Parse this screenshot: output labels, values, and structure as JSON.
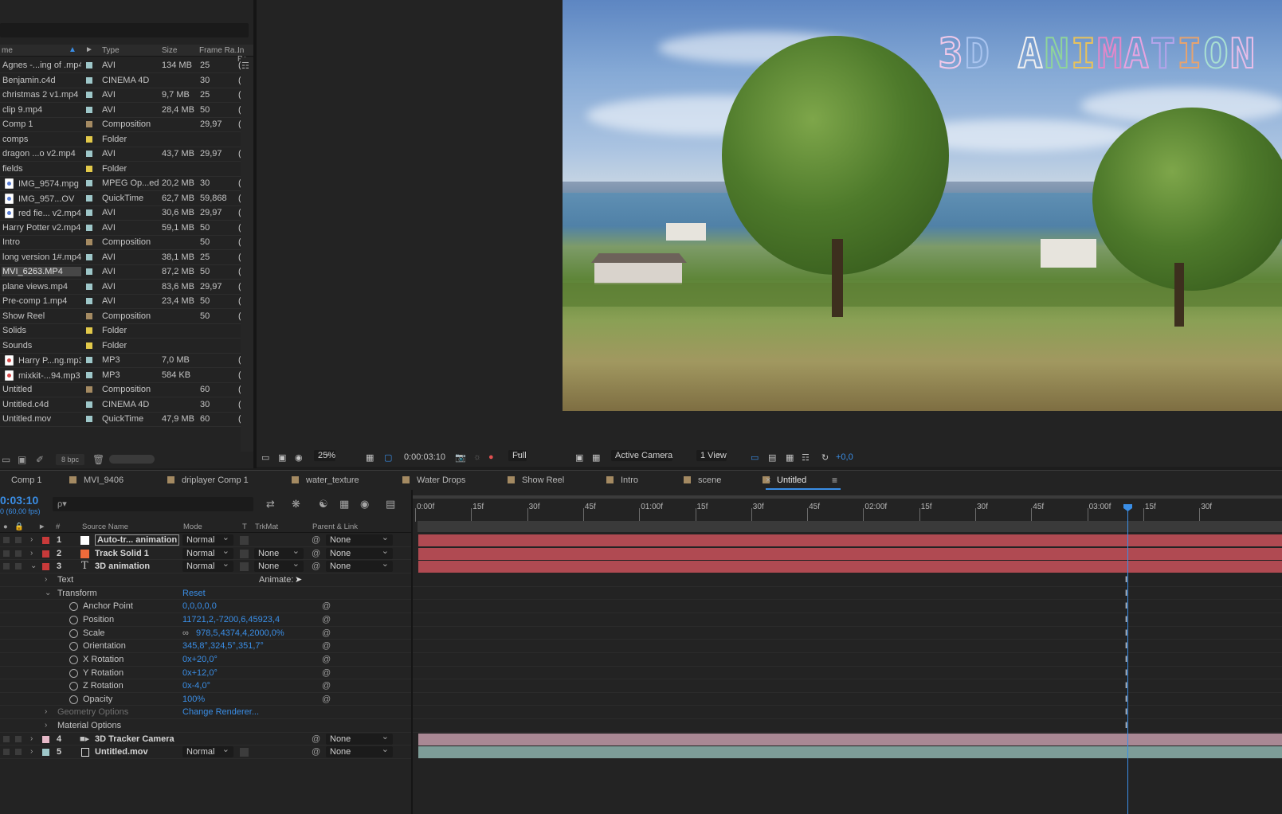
{
  "project": {
    "columns": {
      "name": "me",
      "type": "Type",
      "size": "Size",
      "frame_rate": "Frame Ra...",
      "in_point": "In Po"
    },
    "items": [
      {
        "name": "Agnes -...ing of .mp4",
        "color": "#9ec7c9",
        "type": "AVI",
        "size": "134 MB",
        "rate": "25",
        "in": "(",
        "icon": "none"
      },
      {
        "name": "Benjamin.c4d",
        "color": "#9ec7c9",
        "type": "CINEMA 4D",
        "size": "",
        "rate": "30",
        "in": "(",
        "icon": "none"
      },
      {
        "name": "christmas 2 v1.mp4",
        "color": "#9ec7c9",
        "type": "AVI",
        "size": "9,7 MB",
        "rate": "25",
        "in": "(",
        "icon": "none"
      },
      {
        "name": "clip 9.mp4",
        "color": "#9ec7c9",
        "type": "AVI",
        "size": "28,4 MB",
        "rate": "50",
        "in": "(",
        "icon": "none"
      },
      {
        "name": "Comp 1",
        "color": "#a48a62",
        "type": "Composition",
        "size": "",
        "rate": "29,97",
        "in": "(",
        "icon": "none"
      },
      {
        "name": "comps",
        "color": "#e2c94a",
        "type": "Folder",
        "size": "",
        "rate": "",
        "in": "",
        "icon": "none"
      },
      {
        "name": "dragon ...o v2.mp4",
        "color": "#9ec7c9",
        "type": "AVI",
        "size": "43,7 MB",
        "rate": "29,97",
        "in": "(",
        "icon": "none"
      },
      {
        "name": "fields",
        "color": "#e2c94a",
        "type": "Folder",
        "size": "",
        "rate": "",
        "in": "",
        "icon": "none"
      },
      {
        "name": "IMG_9574.mpg",
        "color": "#9ec7c9",
        "type": "MPEG Op...ed",
        "size": "20,2 MB",
        "rate": "30",
        "in": "(",
        "icon": "video"
      },
      {
        "name": "IMG_957...OV",
        "color": "#9ec7c9",
        "type": "QuickTime",
        "size": "62,7 MB",
        "rate": "59,868",
        "in": "(",
        "icon": "video"
      },
      {
        "name": "red fie... v2.mp4",
        "color": "#9ec7c9",
        "type": "AVI",
        "size": "30,6 MB",
        "rate": "29,97",
        "in": "(",
        "icon": "video"
      },
      {
        "name": "Harry Potter v2.mp4",
        "color": "#9ec7c9",
        "type": "AVI",
        "size": "59,1 MB",
        "rate": "50",
        "in": "(",
        "icon": "none"
      },
      {
        "name": "Intro",
        "color": "#a48a62",
        "type": "Composition",
        "size": "",
        "rate": "50",
        "in": "(",
        "icon": "none"
      },
      {
        "name": "long version 1#.mp4",
        "color": "#9ec7c9",
        "type": "AVI",
        "size": "38,1 MB",
        "rate": "25",
        "in": "(",
        "icon": "none"
      },
      {
        "name": "MVI_6263.MP4",
        "color": "#9ec7c9",
        "type": "AVI",
        "size": "87,2 MB",
        "rate": "50",
        "in": "(",
        "icon": "none",
        "selected": true
      },
      {
        "name": "plane views.mp4",
        "color": "#9ec7c9",
        "type": "AVI",
        "size": "83,6 MB",
        "rate": "29,97",
        "in": "(",
        "icon": "none"
      },
      {
        "name": "Pre-comp 1.mp4",
        "color": "#9ec7c9",
        "type": "AVI",
        "size": "23,4 MB",
        "rate": "50",
        "in": "(",
        "icon": "none"
      },
      {
        "name": "Show Reel",
        "color": "#a48a62",
        "type": "Composition",
        "size": "",
        "rate": "50",
        "in": "(",
        "icon": "none"
      },
      {
        "name": "Solids",
        "color": "#e2c94a",
        "type": "Folder",
        "size": "",
        "rate": "",
        "in": "",
        "icon": "none"
      },
      {
        "name": "Sounds",
        "color": "#e2c94a",
        "type": "Folder",
        "size": "",
        "rate": "",
        "in": "",
        "icon": "none"
      },
      {
        "name": "Harry P...ng.mp3",
        "color": "#9ec7c9",
        "type": "MP3",
        "size": "7,0 MB",
        "rate": "",
        "in": "(",
        "icon": "audio"
      },
      {
        "name": "mixkit-...94.mp3",
        "color": "#9ec7c9",
        "type": "MP3",
        "size": "584 KB",
        "rate": "",
        "in": "(",
        "icon": "audio"
      },
      {
        "name": "Untitled",
        "color": "#a48a62",
        "type": "Composition",
        "size": "",
        "rate": "60",
        "in": "(",
        "icon": "none"
      },
      {
        "name": "Untitled.c4d",
        "color": "#9ec7c9",
        "type": "CINEMA 4D",
        "size": "",
        "rate": "30",
        "in": "(",
        "icon": "none"
      },
      {
        "name": "Untitled.mov",
        "color": "#9ec7c9",
        "type": "QuickTime",
        "size": "47,9 MB",
        "rate": "60",
        "in": "(",
        "icon": "none"
      }
    ],
    "footer": {
      "bpc": "8 bpc"
    }
  },
  "viewer": {
    "title_text": "3D ANIMATION",
    "title_letter_colors": [
      "#f1c9e9",
      "#a9c4ef",
      "#f0f0f0",
      "#8fd49b",
      "#e8c25b",
      "#e387c9",
      "#e9a3e0",
      "#b4a4ea",
      "#e6a36f",
      "#a9e0d2",
      "#e7bde8",
      "#f3d3ef"
    ],
    "bar": {
      "zoom": "25%",
      "timecode": "0:00:03:10",
      "resolution": "Full",
      "camera": "Active Camera",
      "views": "1 View",
      "exposure": "+0,0"
    }
  },
  "timeline": {
    "tabs": [
      {
        "label": "Comp 1",
        "swatch": false
      },
      {
        "label": "MVI_9406",
        "swatch": true
      },
      {
        "label": "driplayer Comp 1",
        "swatch": true
      },
      {
        "label": "water_texture",
        "swatch": true
      },
      {
        "label": "Water Drops",
        "swatch": true
      },
      {
        "label": "Show Reel",
        "swatch": true
      },
      {
        "label": "Intro",
        "swatch": true
      },
      {
        "label": "scene",
        "swatch": true
      },
      {
        "label": "Untitled",
        "swatch": true,
        "active": true
      }
    ],
    "close_glyph": "×",
    "menu_glyph": "≡",
    "timecode": "0:03:10",
    "fps": "0 (60,00 fps)",
    "search_placeholder": "ρ▾",
    "columns": {
      "hash": "#",
      "source": "Source Name",
      "mode": "Mode",
      "t": "T",
      "trkmat": "TrkMat",
      "parent": "Parent & Link"
    },
    "layers": [
      {
        "num": "1",
        "name": "Auto-tr... animation",
        "label_color": "#c83a3a",
        "mode": "Normal",
        "trkmat": "",
        "parent": "None",
        "icon": "solid-white"
      },
      {
        "num": "2",
        "name": "Track Solid 1",
        "label_color": "#c83a3a",
        "mode": "Normal",
        "trkmat": "None",
        "parent": "None",
        "icon": "solid-orange"
      },
      {
        "num": "3",
        "name": "3D animation",
        "label_color": "#c83a3a",
        "mode": "Normal",
        "trkmat": "None",
        "parent": "None",
        "icon": "text"
      },
      {
        "num": "4",
        "name": "3D Tracker Camera",
        "label_color": "#e6b9c8",
        "mode": "",
        "trkmat": "",
        "parent": "None",
        "icon": "camera"
      },
      {
        "num": "5",
        "name": "Untitled.mov",
        "label_color": "#9ec7c9",
        "mode": "Normal",
        "trkmat": "",
        "parent": "None",
        "icon": "footage"
      }
    ],
    "text_group": {
      "label": "Text",
      "animate_label": "Animate:"
    },
    "transform": {
      "label": "Transform",
      "reset": "Reset",
      "props": [
        {
          "name": "Anchor Point",
          "value": "0,0,0,0,0"
        },
        {
          "name": "Position",
          "value": "11721,2,-7200,6,45923,4"
        },
        {
          "name": "Scale",
          "value": "978,5,4374,4,2000,0%"
        },
        {
          "name": "Orientation",
          "value": "345,8°,324,5°,351,7°"
        },
        {
          "name": "X Rotation",
          "value": "0x+20,0°"
        },
        {
          "name": "Y Rotation",
          "value": "0x+12,0°"
        },
        {
          "name": "Z Rotation",
          "value": "0x-4,0°"
        },
        {
          "name": "Opacity",
          "value": "100%"
        }
      ]
    },
    "geometry": {
      "label": "Geometry Options",
      "action": "Change Renderer..."
    },
    "material": {
      "label": "Material Options"
    },
    "ruler_labels": [
      "0:00f",
      "15f",
      "30f",
      "45f",
      "01:00f",
      "15f",
      "30f",
      "45f",
      "02:00f",
      "15f",
      "30f",
      "45f",
      "03:00f",
      "15f",
      "30f"
    ],
    "layer_bar_colors": [
      "#b04a52",
      "#b04a52",
      "#b04a52",
      "#a98894",
      "#7d9d98"
    ]
  }
}
